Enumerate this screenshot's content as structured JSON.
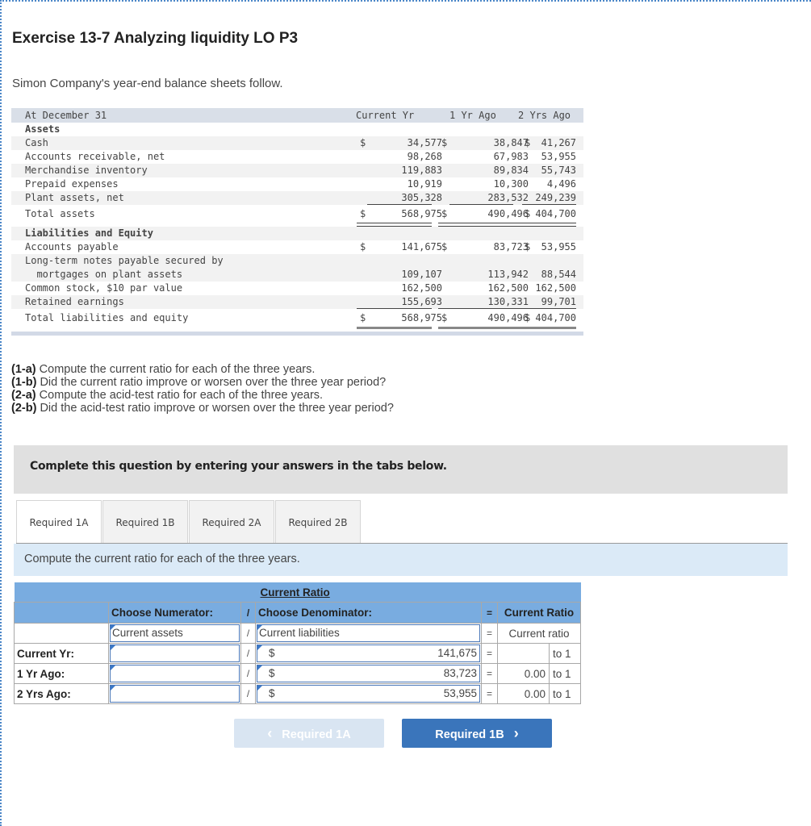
{
  "title": "Exercise 13-7 Analyzing liquidity LO P3",
  "intro": "Simon Company's year-end balance sheets follow.",
  "balance_sheet": {
    "header": {
      "label": "At December 31",
      "cols": [
        "Current Yr",
        "1 Yr Ago",
        "2 Yrs Ago"
      ]
    },
    "assets_heading": "Assets",
    "assets": [
      {
        "label": "Cash",
        "values": [
          "34,577",
          "38,847",
          "41,267"
        ],
        "dollar": true
      },
      {
        "label": "Accounts receivable, net",
        "values": [
          "98,268",
          "67,983",
          "53,955"
        ]
      },
      {
        "label": "Merchandise inventory",
        "values": [
          "119,883",
          "89,834",
          "55,743"
        ]
      },
      {
        "label": "Prepaid expenses",
        "values": [
          "10,919",
          "10,300",
          "4,496"
        ]
      },
      {
        "label": "Plant assets, net",
        "values": [
          "305,328",
          "283,532",
          "249,239"
        ]
      }
    ],
    "total_assets": {
      "label": "Total assets",
      "values": [
        "568,975",
        "490,496",
        "404,700"
      ]
    },
    "liab_heading": "Liabilities and Equity",
    "liabilities": [
      {
        "label": "Accounts payable",
        "values": [
          "141,675",
          "83,723",
          "53,955"
        ],
        "dollar": true
      },
      {
        "label": "Long-term notes payable secured by",
        "label2": "  mortgages on plant assets",
        "values": [
          "109,107",
          "113,942",
          "88,544"
        ]
      },
      {
        "label": "Common stock, $10 par value",
        "values": [
          "162,500",
          "162,500",
          "162,500"
        ]
      },
      {
        "label": "Retained earnings",
        "values": [
          "155,693",
          "130,331",
          "99,701"
        ]
      }
    ],
    "total_liab": {
      "label": "Total liabilities and equity",
      "values": [
        "568,975",
        "490,496",
        "404,700"
      ]
    },
    "currency": "$"
  },
  "questions": [
    {
      "tag": "(1-a)",
      "text": " Compute the current ratio for each of the three years."
    },
    {
      "tag": "(1-b)",
      "text": " Did the current ratio improve or worsen over the three year period?"
    },
    {
      "tag": "(2-a)",
      "text": " Compute the acid-test ratio for each of the three years."
    },
    {
      "tag": "(2-b)",
      "text": " Did the acid-test ratio improve or worsen over the three year period?"
    }
  ],
  "complete_banner": "Complete this question by entering your answers in the tabs below.",
  "tabs": [
    {
      "label": "Required 1A",
      "active": true
    },
    {
      "label": "Required 1B"
    },
    {
      "label": "Required 2A"
    },
    {
      "label": "Required 2B"
    }
  ],
  "instruction": "Compute the current ratio for each of the three years.",
  "ratio_table": {
    "title": "Current Ratio",
    "numerator_header": "Choose Numerator:",
    "slash": "/",
    "denominator_header": "Choose Denominator:",
    "equals": "=",
    "result_header": "Current Ratio",
    "numerator_choice": "Current assets",
    "denominator_choice": "Current liabilities",
    "result_label": "Current ratio",
    "currency": "$",
    "to_label": "to 1",
    "rows": [
      {
        "label": "Current Yr:",
        "numerator": "",
        "denominator": "141,675",
        "ratio": ""
      },
      {
        "label": "1 Yr Ago:",
        "numerator": "",
        "denominator": "83,723",
        "ratio": "0.00"
      },
      {
        "label": "2 Yrs Ago:",
        "numerator": "",
        "denominator": "53,955",
        "ratio": "0.00"
      }
    ]
  },
  "nav": {
    "prev_label": "Required 1A",
    "prev_icon": "‹",
    "next_label": "Required 1B",
    "next_icon": "›"
  }
}
